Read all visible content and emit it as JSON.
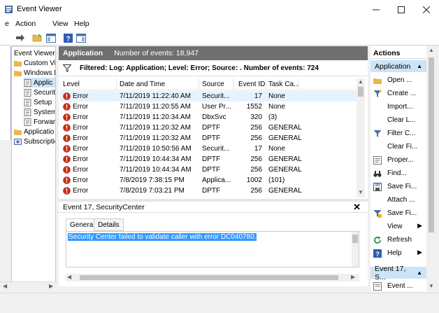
{
  "window": {
    "title": "Event Viewer"
  },
  "menu": [
    {
      "label": "e"
    },
    {
      "label": "Action"
    },
    {
      "label": "View"
    },
    {
      "label": "Help"
    }
  ],
  "tree": {
    "items": [
      {
        "label": "Event Viewer ("
      },
      {
        "label": "Custom Vi"
      },
      {
        "label": "Windows L"
      },
      {
        "label": "Applic"
      },
      {
        "label": "Securit"
      },
      {
        "label": "Setup"
      },
      {
        "label": "System"
      },
      {
        "label": "Forwar"
      },
      {
        "label": "Applicatio"
      },
      {
        "label": "Subscriptic"
      }
    ]
  },
  "log": {
    "name": "Application",
    "count_label": "Number of events: 18,947",
    "filter_text": "Filtered: Log: Application; Level: Error; Source: . Number of events: 724"
  },
  "grid": {
    "columns": [
      "Level",
      "Date and Time",
      "Source",
      "Event ID",
      "Task Ca..."
    ],
    "rows": [
      {
        "level": "Error",
        "datetime": "7/11/2019 11:22:40 AM",
        "source": "Securit...",
        "event_id": "17",
        "task": "None"
      },
      {
        "level": "Error",
        "datetime": "7/11/2019 11:20:55 AM",
        "source": "User Pr...",
        "event_id": "1552",
        "task": "None"
      },
      {
        "level": "Error",
        "datetime": "7/11/2019 11:20:34 AM",
        "source": "DbxSvc",
        "event_id": "320",
        "task": "(3)"
      },
      {
        "level": "Error",
        "datetime": "7/11/2019 11:20:32 AM",
        "source": "DPTF",
        "event_id": "256",
        "task": "GENERAL"
      },
      {
        "level": "Error",
        "datetime": "7/11/2019 11:20:32 AM",
        "source": "DPTF",
        "event_id": "256",
        "task": "GENERAL"
      },
      {
        "level": "Error",
        "datetime": "7/11/2019 10:50:56 AM",
        "source": "Securit...",
        "event_id": "17",
        "task": "None"
      },
      {
        "level": "Error",
        "datetime": "7/11/2019 10:44:34 AM",
        "source": "DPTF",
        "event_id": "256",
        "task": "GENERAL"
      },
      {
        "level": "Error",
        "datetime": "7/11/2019 10:44:34 AM",
        "source": "DPTF",
        "event_id": "256",
        "task": "GENERAL"
      },
      {
        "level": "Error",
        "datetime": "7/8/2019 7:38:15 PM",
        "source": "Applica...",
        "event_id": "1002",
        "task": "(101)"
      },
      {
        "level": "Error",
        "datetime": "7/8/2019 7:03:21 PM",
        "source": "DPTF",
        "event_id": "256",
        "task": "GENERAL"
      }
    ]
  },
  "detail": {
    "title": "Event 17, SecurityCenter",
    "tabs": [
      "General",
      "Details"
    ],
    "message": "Security Center failed to validate caller with error DC040780."
  },
  "actions": {
    "header": "Actions",
    "section1": "Application",
    "items": [
      {
        "label": "Open ..."
      },
      {
        "label": "Create ..."
      },
      {
        "label": "Import..."
      },
      {
        "label": "Clear L..."
      },
      {
        "label": "Filter C..."
      },
      {
        "label": "Clear Fi..."
      },
      {
        "label": "Proper..."
      },
      {
        "label": "Find..."
      },
      {
        "label": "Save Fi..."
      },
      {
        "label": "Attach ..."
      },
      {
        "label": "Save Fi..."
      },
      {
        "label": "View"
      },
      {
        "label": "Refresh"
      },
      {
        "label": "Help"
      }
    ],
    "section2": "Event 17, S...",
    "items2": [
      {
        "label": "Event ..."
      }
    ]
  },
  "colors": {
    "accent_selected": "#cce4f7",
    "header_gray": "#707070",
    "error_red": "#c42b1c",
    "selection_blue": "#3399ff"
  }
}
